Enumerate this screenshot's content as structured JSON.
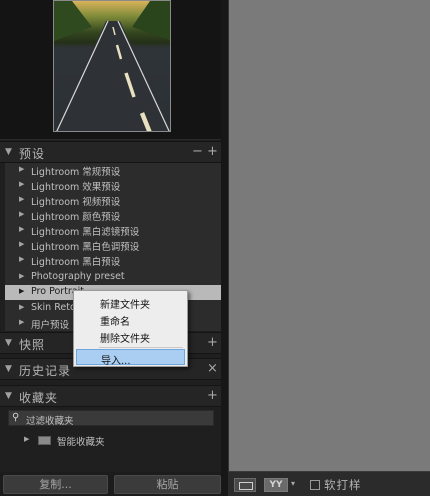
{
  "left_panel": {
    "presets_section": {
      "title": "预设",
      "minus": "−",
      "plus": "+",
      "items": [
        {
          "label": "Lightroom 常规预设"
        },
        {
          "label": "Lightroom 效果预设"
        },
        {
          "label": "Lightroom 视频预设"
        },
        {
          "label": "Lightroom 颜色预设"
        },
        {
          "label": "Lightroom 黑白滤镜预设"
        },
        {
          "label": "Lightroom 黑白色调预设"
        },
        {
          "label": "Lightroom 黑白预设"
        },
        {
          "label": "Photography preset"
        },
        {
          "label": "Pro Portrait ...",
          "selected": true
        },
        {
          "label": "Skin Retou..."
        },
        {
          "label": "用户预设"
        }
      ]
    },
    "snapshots_section": {
      "title": "快照",
      "plus": "+"
    },
    "history_section": {
      "title": "历史记录",
      "close": "×"
    },
    "collections_section": {
      "title": "收藏夹",
      "plus": "+",
      "filter_label": "过滤收藏夹",
      "smart_collection_label": "智能收藏夹"
    },
    "bottom_buttons": {
      "copy": "复制...",
      "paste": "粘贴"
    }
  },
  "context_menu": {
    "items": [
      "新建文件夹",
      "重命名",
      "删除文件夹"
    ],
    "highlighted_item": "导入..."
  },
  "toolbar": {
    "compare_glyph": "YY",
    "caret": "▾",
    "soft_proof_label": "软打样"
  },
  "colors": {
    "panel_bg": "#1f1f1f",
    "preset_list_bg": "#2c2c2c",
    "selected_row": "#b9b9b9",
    "menu_highlight": "#a9cef2",
    "canvas_gray": "#7a7a7a"
  }
}
